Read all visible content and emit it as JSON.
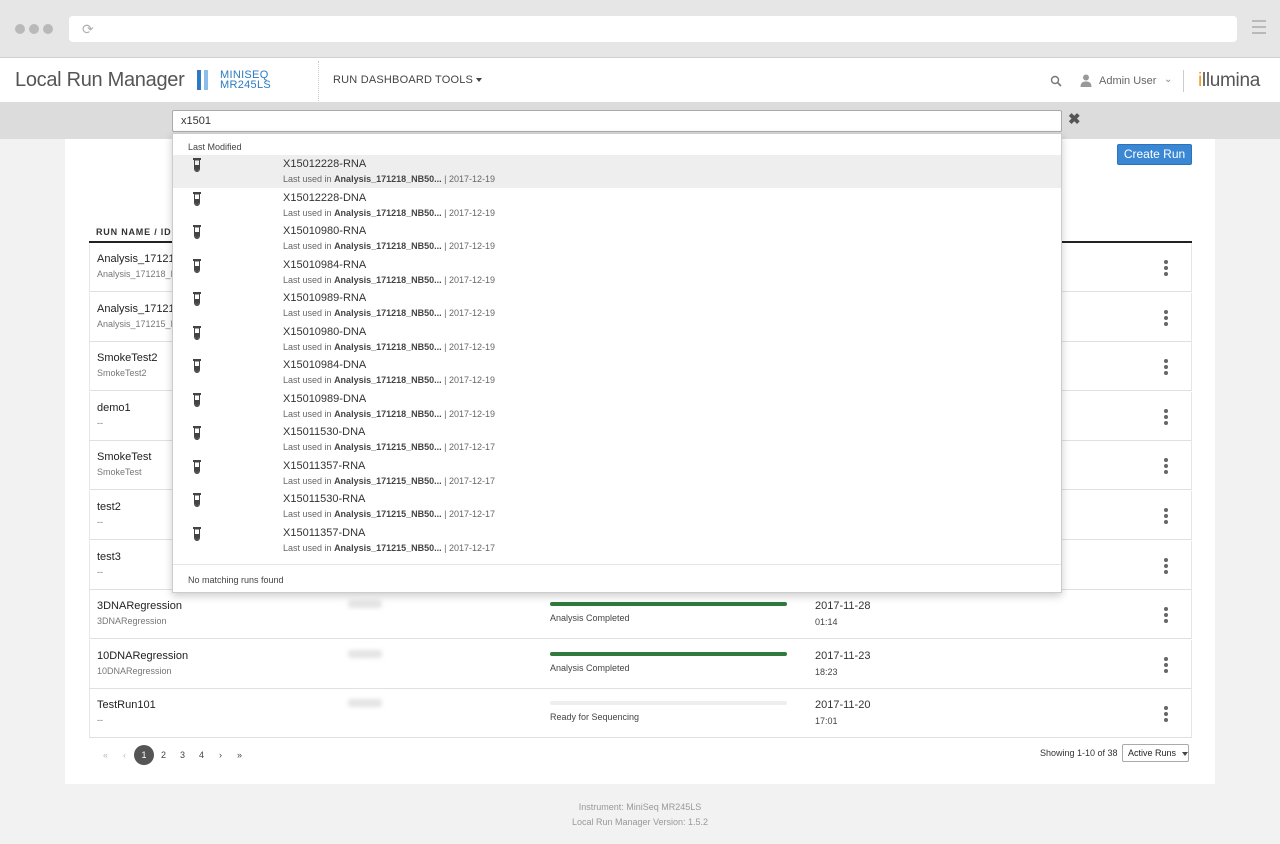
{
  "app": {
    "title": "Local Run Manager",
    "instrument_line1": "MINISEQ",
    "instrument_line2": "MR245LS",
    "brand": "illumina"
  },
  "nav": {
    "run_dashboard": "RUN DASHBOARD",
    "tools": "TOOLS"
  },
  "user": {
    "name": "Admin User"
  },
  "search": {
    "value": "x1501"
  },
  "dropdown": {
    "header": "Last Modified",
    "last_used_prefix": "Last used in",
    "empty_message": "No matching runs found",
    "items": [
      {
        "name": "X15012228-RNA",
        "analysis": "Analysis_171218_NB50...",
        "date": "2017-12-19"
      },
      {
        "name": "X15012228-DNA",
        "analysis": "Analysis_171218_NB50...",
        "date": "2017-12-19"
      },
      {
        "name": "X15010980-RNA",
        "analysis": "Analysis_171218_NB50...",
        "date": "2017-12-19"
      },
      {
        "name": "X15010984-RNA",
        "analysis": "Analysis_171218_NB50...",
        "date": "2017-12-19"
      },
      {
        "name": "X15010989-RNA",
        "analysis": "Analysis_171218_NB50...",
        "date": "2017-12-19"
      },
      {
        "name": "X15010980-DNA",
        "analysis": "Analysis_171218_NB50...",
        "date": "2017-12-19"
      },
      {
        "name": "X15010984-DNA",
        "analysis": "Analysis_171218_NB50...",
        "date": "2017-12-19"
      },
      {
        "name": "X15010989-DNA",
        "analysis": "Analysis_171218_NB50...",
        "date": "2017-12-19"
      },
      {
        "name": "X15011530-DNA",
        "analysis": "Analysis_171215_NB50...",
        "date": "2017-12-17"
      },
      {
        "name": "X15011357-RNA",
        "analysis": "Analysis_171215_NB50...",
        "date": "2017-12-17"
      },
      {
        "name": "X15011530-RNA",
        "analysis": "Analysis_171215_NB50...",
        "date": "2017-12-17"
      },
      {
        "name": "X15011357-DNA",
        "analysis": "Analysis_171215_NB50...",
        "date": "2017-12-17"
      }
    ]
  },
  "main": {
    "create_run_label": "Create Run",
    "column_run_name": "RUN NAME / ID",
    "runs": [
      {
        "name": "Analysis_17121",
        "id": "Analysis_171218_I"
      },
      {
        "name": "Analysis_17121",
        "id": "Analysis_171215_I"
      },
      {
        "name": "SmokeTest2",
        "id": "SmokeTest2"
      },
      {
        "name": "demo1",
        "id": "--"
      },
      {
        "name": "SmokeTest",
        "id": "SmokeTest"
      },
      {
        "name": "test2",
        "id": "--"
      },
      {
        "name": "test3",
        "id": "--"
      },
      {
        "name": "3DNARegression",
        "id": "3DNARegression",
        "status": "Analysis Completed",
        "progress": 1.0,
        "date": "2017-11-28",
        "time": "01:14"
      },
      {
        "name": "10DNARegression",
        "id": "10DNARegression",
        "status": "Analysis Completed",
        "progress": 1.0,
        "date": "2017-11-23",
        "time": "18:23"
      },
      {
        "name": "TestRun101",
        "id": "--",
        "status": "Ready for Sequencing",
        "progress": 0.0,
        "date": "2017-11-20",
        "time": "17:01"
      }
    ]
  },
  "pagination": {
    "first": "«",
    "prev": "‹",
    "next": "›",
    "last": "»",
    "pages": [
      "1",
      "2",
      "3",
      "4"
    ],
    "current": "1",
    "showing": "Showing 1-10 of 38",
    "filter": "Active Runs"
  },
  "footer": {
    "instrument": "Instrument: MiniSeq MR245LS",
    "version": "Local Run Manager Version: 1.5.2"
  },
  "colors": {
    "accent": "#3a87d4",
    "progress_complete": "#2f7a3c",
    "brand_mark": "#f29b1d"
  }
}
